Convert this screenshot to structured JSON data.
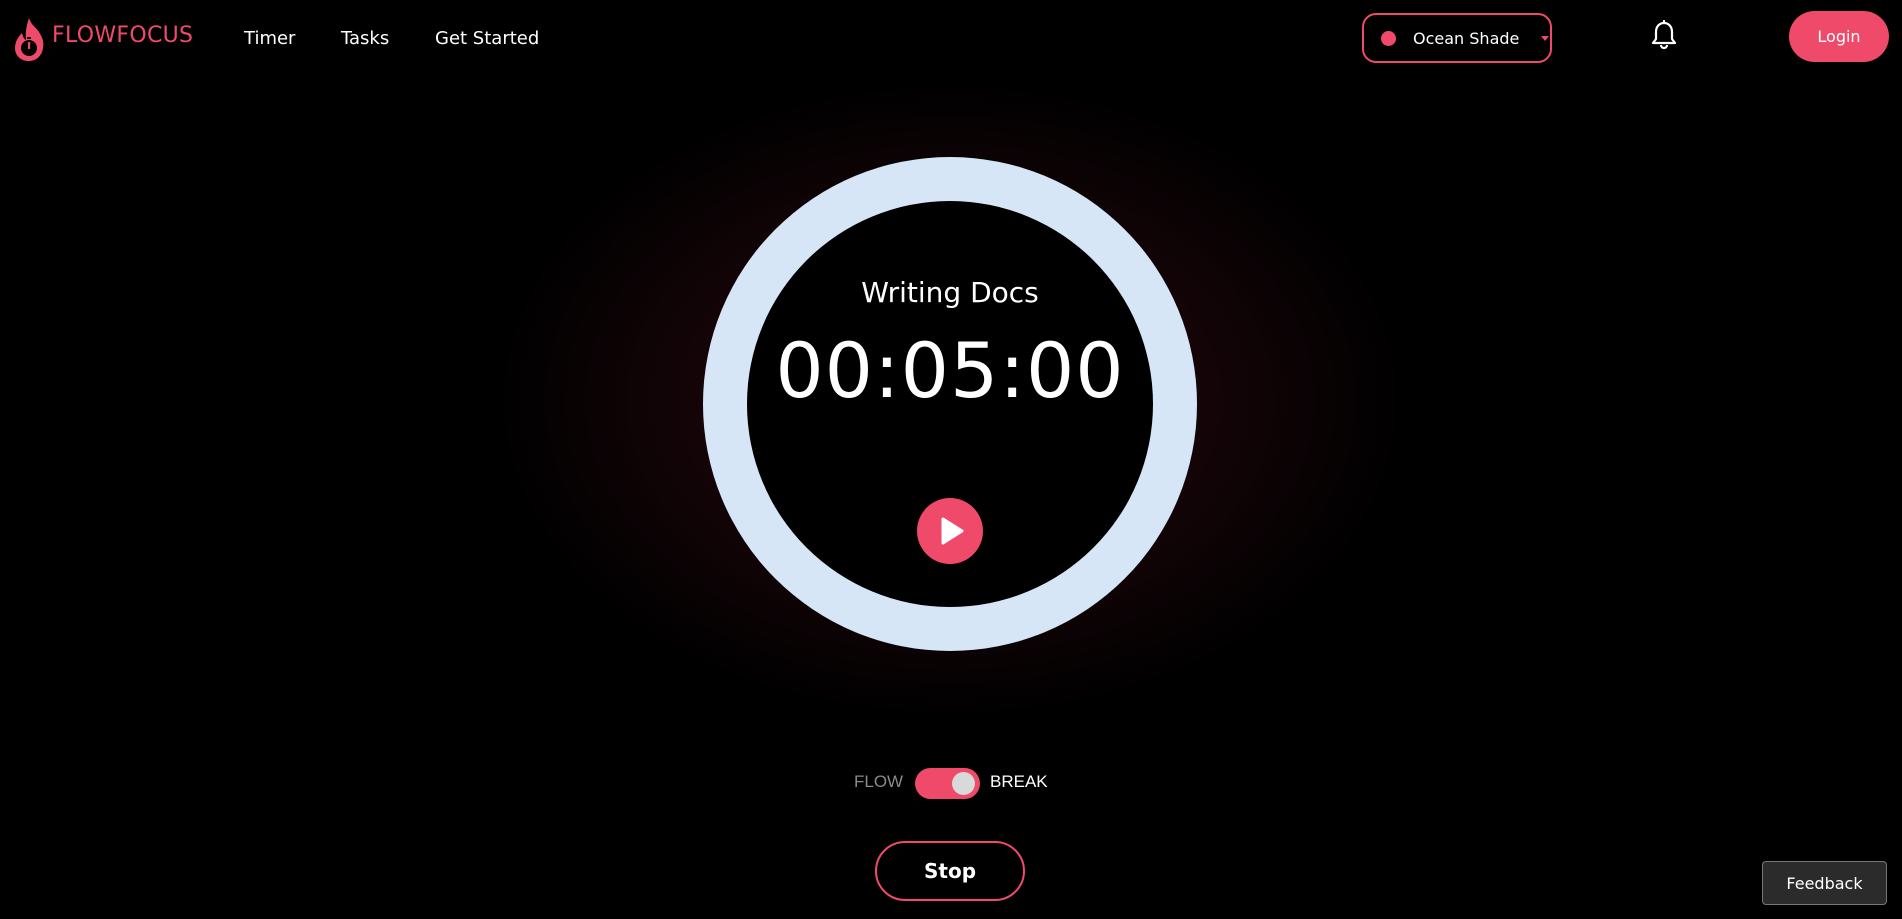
{
  "brand": {
    "name": "FLOWFOCUS",
    "logo_icon": "flame-timer-icon",
    "accent_color": "#ef4a6a"
  },
  "nav": {
    "items": [
      {
        "label": "Timer"
      },
      {
        "label": "Tasks"
      },
      {
        "label": "Get Started"
      }
    ]
  },
  "theme_selector": {
    "selected": "Ocean Shade",
    "dot_color": "#ef4a6a",
    "border_color": "#ef4a6a"
  },
  "notifications": {
    "icon": "bell-icon"
  },
  "auth": {
    "login_label": "Login"
  },
  "timer": {
    "task_name": "Writing Docs",
    "time": "00:05:00",
    "ring_color": "#d6e6f7",
    "play_icon": "play-icon",
    "play_button_color": "#ef4a6a"
  },
  "mode_toggle": {
    "left_label": "FLOW",
    "right_label": "BREAK",
    "selected": "BREAK",
    "left_label_color": "#8a8a8a",
    "right_label_color": "#ffffff",
    "track_color": "#ef4a6a"
  },
  "controls": {
    "stop_label": "Stop",
    "stop_border_color": "#ef4a6a"
  },
  "feedback": {
    "label": "Feedback"
  }
}
